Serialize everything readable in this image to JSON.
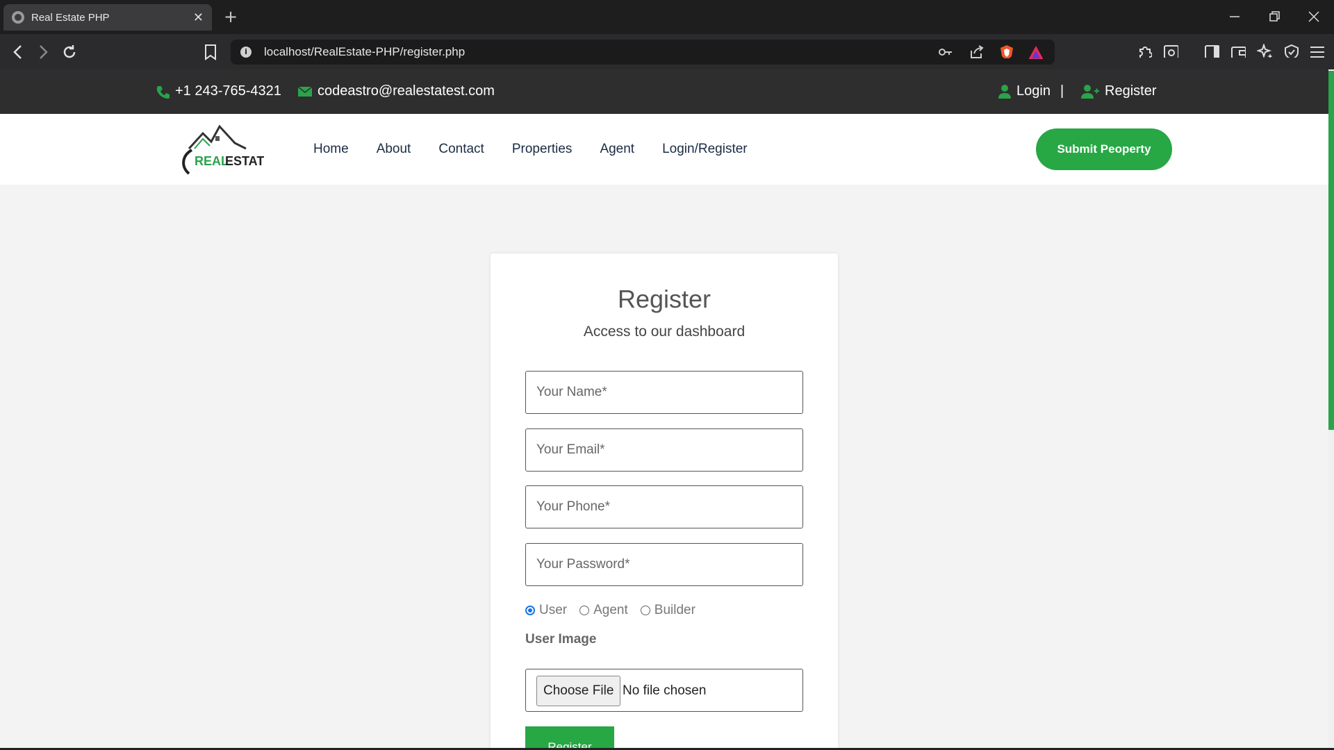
{
  "browser": {
    "tab_title": "Real Estate PHP",
    "tab_close": "✕",
    "new_tab": "+",
    "url": "localhost/RealEstate-PHP/register.php"
  },
  "topbar": {
    "phone": "+1 243-765-4321",
    "email": "codeastro@realestatest.com",
    "login": "Login",
    "separator": "|",
    "register": "Register"
  },
  "logo": {
    "text_a": "REAL",
    "text_b": "ESTATE"
  },
  "nav": {
    "items": [
      "Home",
      "About",
      "Contact",
      "Properties",
      "Agent",
      "Login/Register"
    ],
    "submit": "Submit Peoperty"
  },
  "form": {
    "title": "Register",
    "subtitle": "Access to our dashboard",
    "name_placeholder": "Your Name*",
    "email_placeholder": "Your Email*",
    "phone_placeholder": "Your Phone*",
    "password_placeholder": "Your Password*",
    "roles": [
      "User",
      "Agent",
      "Builder"
    ],
    "selected_role": "User",
    "image_label": "User Image",
    "choose_file": "Choose File",
    "no_file": "No file chosen",
    "submit": "Register"
  },
  "colors": {
    "accent": "#28a745",
    "topbar_bg": "#2e2e2e",
    "radio_checked": "#1a73e8"
  }
}
